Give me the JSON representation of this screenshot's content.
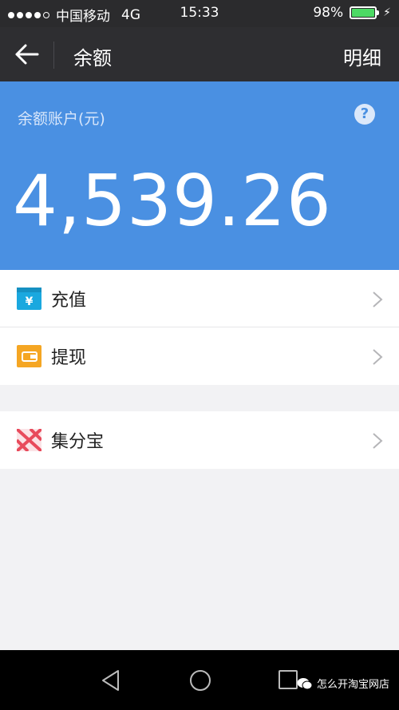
{
  "status_bar": {
    "carrier": "中国移动",
    "network": "4G",
    "time": "15:33",
    "battery": "98%",
    "battery_level": 0.98
  },
  "nav": {
    "title": "余额",
    "action": "明细"
  },
  "balance": {
    "label": "余额账户(元)",
    "help": "?",
    "amount": "4,539.26"
  },
  "menu_groups": [
    {
      "items": [
        {
          "label": "充值",
          "icon": "recharge-icon"
        },
        {
          "label": "提现",
          "icon": "withdraw-icon"
        }
      ]
    },
    {
      "items": [
        {
          "label": "集分宝",
          "icon": "jifenbao-icon"
        }
      ]
    }
  ],
  "watermark": "怎么开淘宝网店",
  "colors": {
    "balance_bg": "#4a90e2",
    "nav_bg": "#2e2e31",
    "recharge_icon": "#1aa8df",
    "withdraw_icon": "#f5a623",
    "jifenbao_icon": "#e84b5c"
  }
}
